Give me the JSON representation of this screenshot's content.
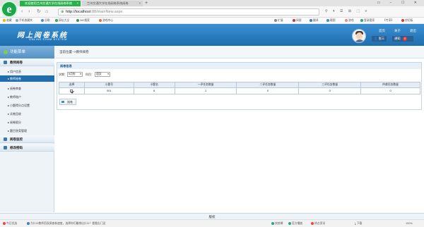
{
  "browser": {
    "tabs": [
      {
        "title": "欢迎使用兰州交通大学在线阅卷系统",
        "active": true
      },
      {
        "title": "兰州交通大学在线阅卷系统阅卷",
        "active": false
      }
    ],
    "url_host": "http://localhost",
    "url_path": ":88/mainNew.aspx",
    "bookmarks": [
      "收藏",
      "手机收藏夹",
      "谷歌",
      "网址大全",
      "360搜索",
      "游戏中心"
    ],
    "toolbar_right": [
      "扩展",
      "网银",
      "翻译",
      "截图",
      "游戏",
      "登录管家"
    ],
    "toolbar_far_right": [
      "【专享】",
      "剪切板"
    ]
  },
  "header": {
    "logo_cn": "网上阅卷系统",
    "logo_en": "ONLINE EXAM SYSTEM",
    "links": [
      "首页",
      "关于",
      "退出"
    ],
    "user_name": "张三",
    "notice_label": "通知",
    "notice_count": "0"
  },
  "sidebar": {
    "title": "功能菜单",
    "groups": [
      {
        "label": "教师阅卷",
        "items": [
          "用户信息",
          "教师阅卷",
          "阅卷审查",
          "教师账户",
          "小题得分点设置",
          "试卷回收",
          "阅卷赋分",
          "题目答案管理"
        ]
      },
      {
        "label": "阅卷监控",
        "items": []
      },
      {
        "label": "修改密码",
        "items": []
      }
    ],
    "active_item": "教师阅卷"
  },
  "main": {
    "breadcrumb": "当前位置-->教师阅卷",
    "panel_title": "阅卷信息",
    "filters": {
      "term_label": "学期：",
      "term_value": "5月份",
      "subject_label": "科目：",
      "subject_value": "语文"
    },
    "table": {
      "columns": [
        "选择",
        "小题号",
        "小题名",
        "一评任务数量",
        "二评任务数量",
        "三评任务数量",
        "仲裁任务数量"
      ],
      "rows": [
        [
          "",
          "001",
          "6",
          "1",
          "0",
          "0",
          "0"
        ]
      ]
    },
    "read_button": "阅卷"
  },
  "footer": {
    "text": "版权"
  },
  "statusbar": {
    "left": [
      "今日优选",
      "为什么教师用双屏查卷速度，选择你们最想出什么？看看出门没"
    ],
    "right": [
      "快剪辑",
      "官方播放",
      "热点资讯",
      "下载",
      "100%"
    ]
  }
}
